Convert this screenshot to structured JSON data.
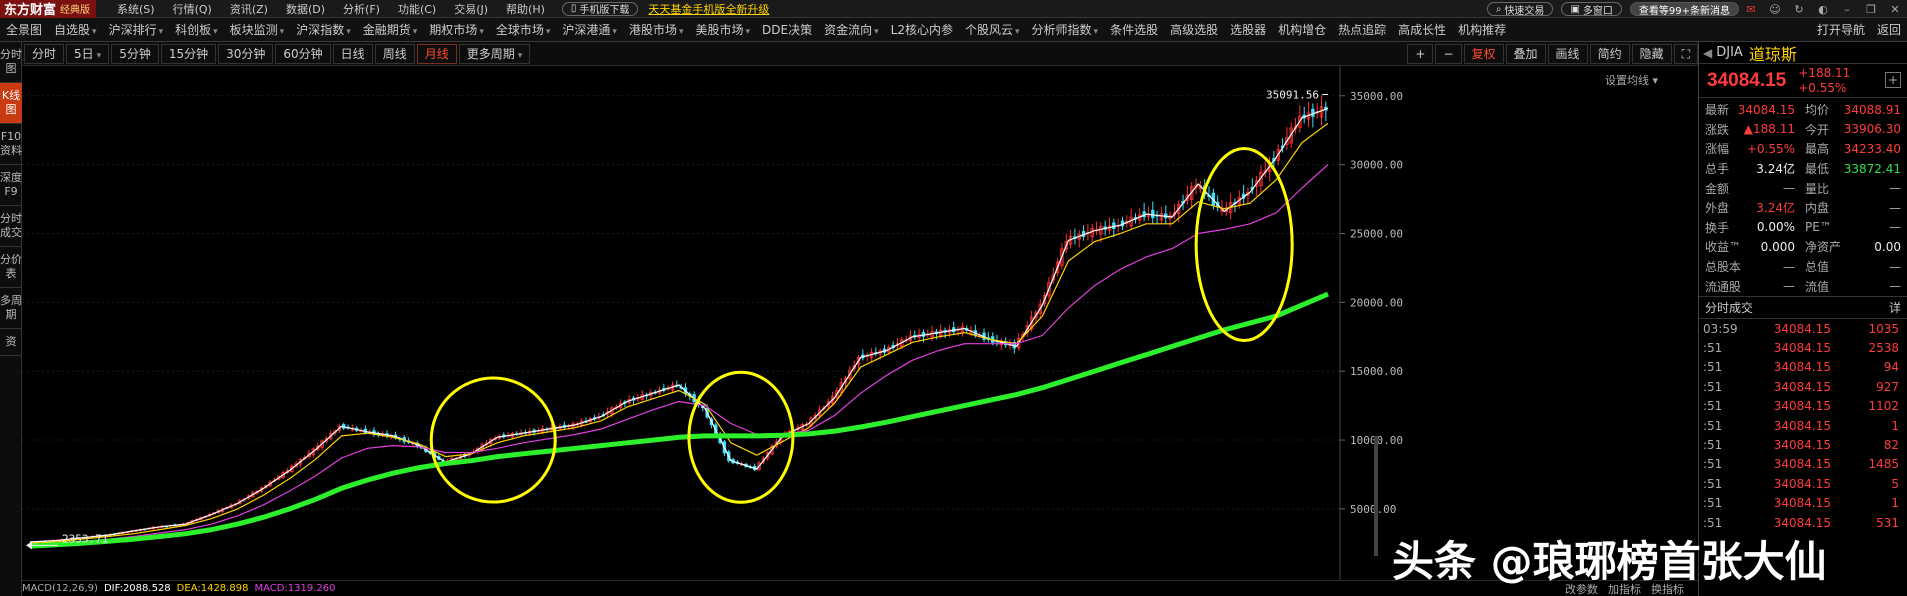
{
  "title_bar": {
    "brand": "东方财富",
    "edition": "经典版",
    "menus": [
      "系统(S)",
      "行情(Q)",
      "资讯(Z)",
      "数据(D)",
      "分析(F)",
      "功能(C)",
      "交易(J)",
      "帮助(H)"
    ],
    "mobile_download": "手机版下载",
    "promo": "天天基金手机版全新升级",
    "quick_trade": "快速交易",
    "multi_window": "多窗口",
    "news_button": "查看等99+条新消息"
  },
  "nav": {
    "items": [
      "全景图",
      "自选股",
      "沪深排行",
      "科创板",
      "板块监测",
      "沪深指数",
      "金融期货",
      "期权市场",
      "全球市场",
      "沪深港通",
      "港股市场",
      "美股市场",
      "DDE决策",
      "资金流向",
      "L2核心内参",
      "个股风云",
      "分析师指数",
      "条件选股",
      "高级选股",
      "选股器",
      "机构增仓",
      "热点追踪",
      "高成长性",
      "机构推荐"
    ],
    "open_nav": "打开导航",
    "back": "返回"
  },
  "left_tabs": [
    "分时图",
    "K线图",
    "F10资料",
    "深度F9",
    "分时成交",
    "分价表",
    "多周期",
    "资"
  ],
  "periods": [
    "分时",
    "5日",
    "5分钟",
    "15分钟",
    "30分钟",
    "60分钟",
    "日线",
    "周线",
    "月线",
    "更多周期"
  ],
  "active_period": "月线",
  "chart_toolbar_right": [
    "+",
    "−",
    "复权",
    "叠加",
    "画线",
    "简约",
    "隐藏"
  ],
  "settings_ma": "设置均线",
  "chart_data": {
    "type": "line",
    "axis_labels": [
      "35000.00",
      "30000.00",
      "25000.00",
      "20000.00",
      "15000.00",
      "10000.00",
      "5000.00"
    ],
    "ylim": [
      1000,
      36000
    ],
    "max_label": "35091.56",
    "min_label": "2353.71",
    "series": [
      {
        "color": "#ffffff",
        "values": [
          2600,
          2700,
          2900,
          3100,
          3400,
          3700,
          3900,
          4600,
          5400,
          6500,
          7800,
          9300,
          11000,
          10600,
          10300,
          9600,
          8400,
          9000,
          10200,
          10500,
          10800,
          11100,
          11700,
          12800,
          13400,
          14000,
          12300,
          8500,
          7900,
          10300,
          11200,
          13100,
          16000,
          16500,
          17500,
          17800,
          18100,
          17300,
          16800,
          19800,
          24500,
          25200,
          25600,
          26400,
          26200,
          28600,
          26600,
          28000,
          30500,
          33400,
          34084
        ]
      },
      {
        "color": "#ffd200",
        "values": [
          2500,
          2600,
          2800,
          3000,
          3200,
          3500,
          3800,
          4300,
          5000,
          6000,
          7200,
          8600,
          10300,
          10500,
          10200,
          9700,
          8800,
          9000,
          9800,
          10300,
          10600,
          10900,
          11400,
          12400,
          13000,
          13600,
          12600,
          9800,
          8900,
          9900,
          10900,
          12700,
          15300,
          16200,
          17100,
          17500,
          17800,
          17300,
          17000,
          19000,
          23000,
          24400,
          25000,
          25700,
          25700,
          27300,
          26800,
          27200,
          28900,
          31600,
          33000
        ]
      },
      {
        "color": "#e040e0",
        "values": [
          2400,
          2500,
          2650,
          2800,
          3000,
          3250,
          3500,
          3900,
          4500,
          5300,
          6300,
          7400,
          8700,
          9400,
          9600,
          9500,
          9100,
          9100,
          9400,
          9800,
          10100,
          10400,
          10800,
          11500,
          12200,
          12800,
          12500,
          11200,
          10400,
          10400,
          10700,
          11800,
          13400,
          14700,
          15800,
          16500,
          17000,
          17000,
          17000,
          17600,
          19600,
          21200,
          22400,
          23300,
          23900,
          25000,
          25300,
          25700,
          26500,
          28300,
          30000
        ]
      },
      {
        "color": "#2cf02c",
        "values": [
          2300,
          2400,
          2500,
          2650,
          2800,
          3000,
          3200,
          3500,
          3900,
          4400,
          5000,
          5700,
          6500,
          7100,
          7600,
          8000,
          8300,
          8500,
          8800,
          9000,
          9200,
          9400,
          9600,
          9800,
          10000,
          10200,
          10300,
          10300,
          10300,
          10350,
          10450,
          10650,
          10950,
          11300,
          11700,
          12100,
          12500,
          12900,
          13300,
          13800,
          14400,
          15000,
          15600,
          16200,
          16800,
          17400,
          18000,
          18500,
          19000,
          19800,
          20600
        ]
      }
    ],
    "highlight_circles": 4
  },
  "indicator": {
    "name": "MACD(12,26,9)",
    "dif": "DIF:2088.528",
    "dea": "DEA:1428.898",
    "macd": "MACD:1319.260",
    "buttons": [
      "改参数",
      "加指标",
      "换指标"
    ]
  },
  "quote": {
    "code": "DJIA",
    "name": "道琼斯",
    "price": "34084.15",
    "change": "+188.11",
    "change_pct": "+0.55%",
    "stats": [
      {
        "l1": "最新",
        "v1": "34084.15",
        "c1": "red",
        "l2": "均价",
        "v2": "34088.91",
        "c2": "red"
      },
      {
        "l1": "涨跌",
        "v1": "▲188.11",
        "c1": "red",
        "l2": "今开",
        "v2": "33906.30",
        "c2": "red"
      },
      {
        "l1": "涨幅",
        "v1": "+0.55%",
        "c1": "red",
        "l2": "最高",
        "v2": "34233.40",
        "c2": "red"
      },
      {
        "l1": "总手",
        "v1": "3.24亿",
        "c1": "white",
        "l2": "最低",
        "v2": "33872.41",
        "c2": "green"
      },
      {
        "l1": "金额",
        "v1": "—",
        "c1": "gray",
        "l2": "量比",
        "v2": "—",
        "c2": "gray"
      },
      {
        "l1": "外盘",
        "v1": "3.24亿",
        "c1": "red",
        "l2": "内盘",
        "v2": "—",
        "c2": "gray"
      },
      {
        "l1": "换手",
        "v1": "0.00%",
        "c1": "white",
        "l2": "PE™",
        "v2": "—",
        "c2": "gray"
      },
      {
        "l1": "收益™",
        "v1": "0.000",
        "c1": "white",
        "l2": "净资产",
        "v2": "0.00",
        "c2": "white"
      },
      {
        "l1": "总股本",
        "v1": "—",
        "c1": "gray",
        "l2": "总值",
        "v2": "—",
        "c2": "gray"
      },
      {
        "l1": "流通股",
        "v1": "—",
        "c1": "gray",
        "l2": "流值",
        "v2": "—",
        "c2": "gray"
      }
    ],
    "ticks_title": "分时成交",
    "ticks_more": "详",
    "ticks": [
      {
        "time": "03:59",
        "price": "34084.15",
        "vol": "1035"
      },
      {
        "time": ":51",
        "price": "34084.15",
        "vol": "2538"
      },
      {
        "time": ":51",
        "price": "34084.15",
        "vol": "94"
      },
      {
        "time": ":51",
        "price": "34084.15",
        "vol": "927"
      },
      {
        "time": ":51",
        "price": "34084.15",
        "vol": "1102"
      },
      {
        "time": ":51",
        "price": "34084.15",
        "vol": "1"
      },
      {
        "time": ":51",
        "price": "34084.15",
        "vol": "82"
      },
      {
        "time": ":51",
        "price": "34084.15",
        "vol": "1485"
      },
      {
        "time": ":51",
        "price": "34084.15",
        "vol": "5"
      },
      {
        "time": ":51",
        "price": "34084.15",
        "vol": "1"
      },
      {
        "time": ":51",
        "price": "34084.15",
        "vol": "531"
      }
    ]
  },
  "watermark": "头条 @琅琊榜首张大仙"
}
